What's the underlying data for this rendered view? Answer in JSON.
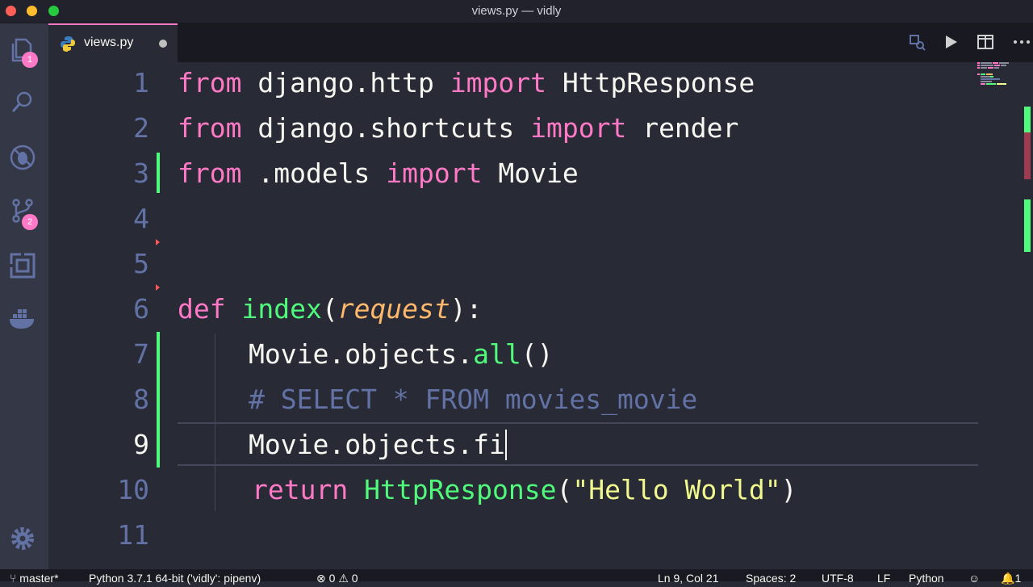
{
  "window": {
    "title": "views.py — vidly"
  },
  "activity_bar": {
    "explorer_badge": "1",
    "source_control_badge": "2"
  },
  "tab": {
    "label": "views.py"
  },
  "editor": {
    "line_numbers": [
      "1",
      "2",
      "3",
      "4",
      "5",
      "6",
      "7",
      "8",
      "9",
      "10",
      "11"
    ],
    "lines": {
      "l1": {
        "t1": "from",
        "t2": " django.http ",
        "t3": "import",
        "t4": " HttpResponse"
      },
      "l2": {
        "t1": "from",
        "t2": " django.shortcuts ",
        "t3": "import",
        "t4": " render"
      },
      "l3": {
        "t1": "from",
        "t2": " .models ",
        "t3": "import",
        "t4": " Movie"
      },
      "l6": {
        "t1": "def",
        "t2": " ",
        "t3": "index",
        "t4": "(",
        "t5": "request",
        "t6": "):"
      },
      "l7": {
        "t1": "Movie.objects.",
        "t2": "all",
        "t3": "()"
      },
      "l8": {
        "t1": "# SELECT * FROM movies_movie"
      },
      "l9": {
        "t1": "Movie.objects.fi"
      },
      "l10": {
        "t1": "return",
        "t2": " ",
        "t3": "HttpResponse",
        "t4": "(",
        "t5": "\"Hello World\"",
        "t6": ")"
      }
    }
  },
  "status_bar": {
    "branch": "master*",
    "interpreter": "Python 3.7.1 64-bit ('vidly': pipenv)",
    "errors": "0",
    "warnings": "0",
    "cursor_position": "Ln 9, Col 21",
    "indentation": "Spaces: 2",
    "encoding": "UTF-8",
    "eol": "LF",
    "language": "Python",
    "notifications": "1"
  },
  "colors": {
    "background": "#282a36",
    "keyword": "#ff79c6",
    "function": "#50fa7b",
    "parameter": "#ffb86c",
    "comment": "#6272a4",
    "string": "#f1fa8c",
    "badge": "#ff79c6"
  },
  "icons": [
    "files-icon",
    "search-icon",
    "debug-icon",
    "source-control-icon",
    "extensions-icon",
    "docker-icon",
    "settings-gear-icon",
    "python-file-icon",
    "open-changes-icon",
    "run-icon",
    "split-editor-icon",
    "more-actions-icon",
    "branch-icon",
    "error-icon",
    "warning-icon",
    "feedback-smiley-icon",
    "bell-icon"
  ]
}
